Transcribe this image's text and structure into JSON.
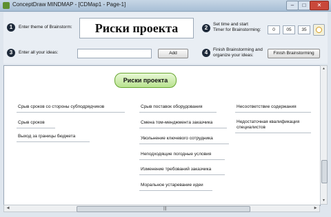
{
  "window": {
    "title": "ConceptDraw MINDMAP - [CDMap1 - Page-1]",
    "min": "–",
    "max": "□",
    "close": "✕"
  },
  "panel": {
    "step1": {
      "num": "1",
      "label": "Enter theme of Brainstorm:",
      "theme": "Риски проекта"
    },
    "step2": {
      "num": "2",
      "label_line1": "Set time and start",
      "label_line2": "Timer for Brainstorming:",
      "timer": [
        "0",
        "05",
        "35"
      ],
      "timer_icon": "clock-icon"
    },
    "step3": {
      "num": "3",
      "label": "Enter all your ideas:",
      "input_value": "",
      "add_label": "Add"
    },
    "step4": {
      "num": "4",
      "label_line1": "Finish Brainstorming and",
      "label_line2": "organize your ideas:",
      "finish_label": "Finish Brainstorming"
    }
  },
  "map": {
    "root": "Риски проекта",
    "ideas_col1": [
      "Срыв сроков со стороны субподрядчиков",
      "Срыв сроков",
      "Выход за границы бюджета"
    ],
    "ideas_col2": [
      "Срыв поставок оборудования",
      "Смена том-менджмента заказчика",
      "Увольнение ключевого сотрудника",
      "Неподходящие погодные условия",
      "Изменение требований заказчика",
      "Моральное устаревание идеи"
    ],
    "ideas_col3": [
      "Несоответствие содержания",
      "Недостаточная квалификация специалистов"
    ]
  },
  "scroll": {
    "up": "▲",
    "down": "▼",
    "left": "◀",
    "right": "▶",
    "grip": "|||"
  }
}
